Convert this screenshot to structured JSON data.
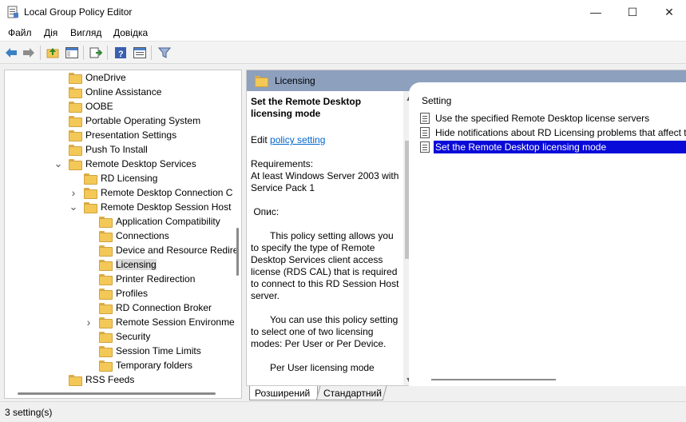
{
  "window": {
    "title": "Local Group Policy Editor",
    "minimize_glyph": "—",
    "maximize_glyph": "☐",
    "close_glyph": "✕"
  },
  "menu": [
    "Файл",
    "Дія",
    "Вигляд",
    "Довідка"
  ],
  "toolbar": {
    "icons": [
      "back-arrow-icon",
      "forward-arrow-icon",
      "up-folder-icon",
      "show-hide-tree-icon",
      "export-list-icon",
      "help-icon",
      "properties-icon",
      "filter-icon"
    ]
  },
  "tree": {
    "items": [
      {
        "label": "OneDrive",
        "level": 3,
        "expander": ""
      },
      {
        "label": "Online Assistance",
        "level": 3,
        "expander": ""
      },
      {
        "label": "OOBE",
        "level": 3,
        "expander": ""
      },
      {
        "label": "Portable Operating System",
        "level": 3,
        "expander": ""
      },
      {
        "label": "Presentation Settings",
        "level": 3,
        "expander": ""
      },
      {
        "label": "Push To Install",
        "level": 3,
        "expander": ""
      },
      {
        "label": "Remote Desktop Services",
        "level": 3,
        "expander": "expanded"
      },
      {
        "label": "RD Licensing",
        "level": 4,
        "expander": ""
      },
      {
        "label": "Remote Desktop Connection C",
        "level": 4,
        "expander": "collapsed"
      },
      {
        "label": "Remote Desktop Session Host",
        "level": 4,
        "expander": "expanded"
      },
      {
        "label": "Application Compatibility",
        "level": 5,
        "expander": ""
      },
      {
        "label": "Connections",
        "level": 5,
        "expander": ""
      },
      {
        "label": "Device and Resource Redire",
        "level": 5,
        "expander": ""
      },
      {
        "label": "Licensing",
        "level": 5,
        "expander": "",
        "selected": true
      },
      {
        "label": "Printer Redirection",
        "level": 5,
        "expander": ""
      },
      {
        "label": "Profiles",
        "level": 5,
        "expander": ""
      },
      {
        "label": "RD Connection Broker",
        "level": 5,
        "expander": ""
      },
      {
        "label": "Remote Session Environme",
        "level": 5,
        "expander": "collapsed"
      },
      {
        "label": "Security",
        "level": 5,
        "expander": ""
      },
      {
        "label": "Session Time Limits",
        "level": 5,
        "expander": ""
      },
      {
        "label": "Temporary folders",
        "level": 5,
        "expander": ""
      },
      {
        "label": "RSS Feeds",
        "level": 3,
        "expander": ""
      }
    ]
  },
  "details": {
    "header": "Licensing",
    "title": "Set the Remote Desktop licensing mode",
    "edit_prefix": "Edit ",
    "edit_link": "policy setting ",
    "requirements_label": "Requirements:",
    "requirements": "At least Windows Server 2003 with Service Pack 1",
    "description_label": " Опис:",
    "para1": "This policy setting allows you to specify the type of Remote Desktop Services client access license (RDS CAL) that is required to connect to this RD Session Host server.",
    "para2": "You can use this policy setting to select one of two licensing modes: Per User or Per Device.",
    "para3": "Per User licensing mode"
  },
  "list": {
    "column_header": "Setting",
    "rows": [
      {
        "label": "Use the specified Remote Desktop license servers",
        "selected": false
      },
      {
        "label": "Hide notifications about RD Licensing problems that affect t",
        "selected": false
      },
      {
        "label": "Set the Remote Desktop licensing mode",
        "selected": true
      }
    ]
  },
  "tabs": {
    "extended": "Розширений",
    "standard": "Стандартний"
  },
  "status": {
    "text": "3 setting(s)"
  }
}
